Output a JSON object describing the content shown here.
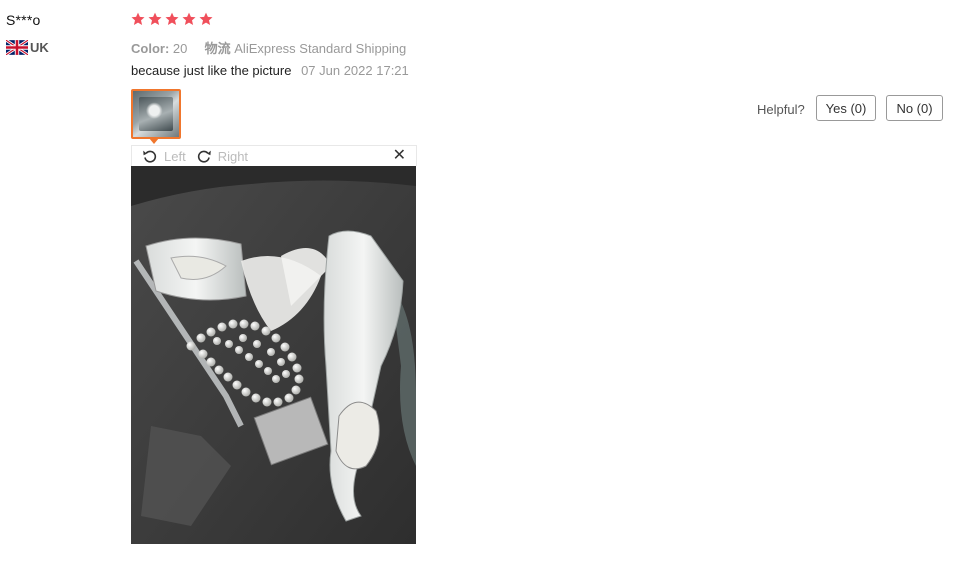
{
  "review": {
    "user_name": "S***o",
    "country_code": "UK",
    "rating": 5,
    "attributes": {
      "color_label": "Color:",
      "color_value": "20",
      "shipping_label": "物流",
      "shipping_value": "AliExpress Standard Shipping"
    },
    "text": "because just like the picture",
    "date": "07 Jun 2022 17:21"
  },
  "viewer": {
    "rotate_left_label": "Left",
    "rotate_right_label": "Right",
    "close_glyph": "✕"
  },
  "helpful": {
    "label": "Helpful?",
    "yes_label": "Yes (0)",
    "no_label": "No (0)"
  },
  "colors": {
    "star": "#f04f5b",
    "thumb_border": "#f0762d",
    "muted_text": "#999999"
  },
  "icons": {
    "flag": "uk-flag-icon",
    "star": "star-icon",
    "rotate_left": "rotate-left-icon",
    "rotate_right": "rotate-right-icon",
    "close": "close-icon"
  }
}
